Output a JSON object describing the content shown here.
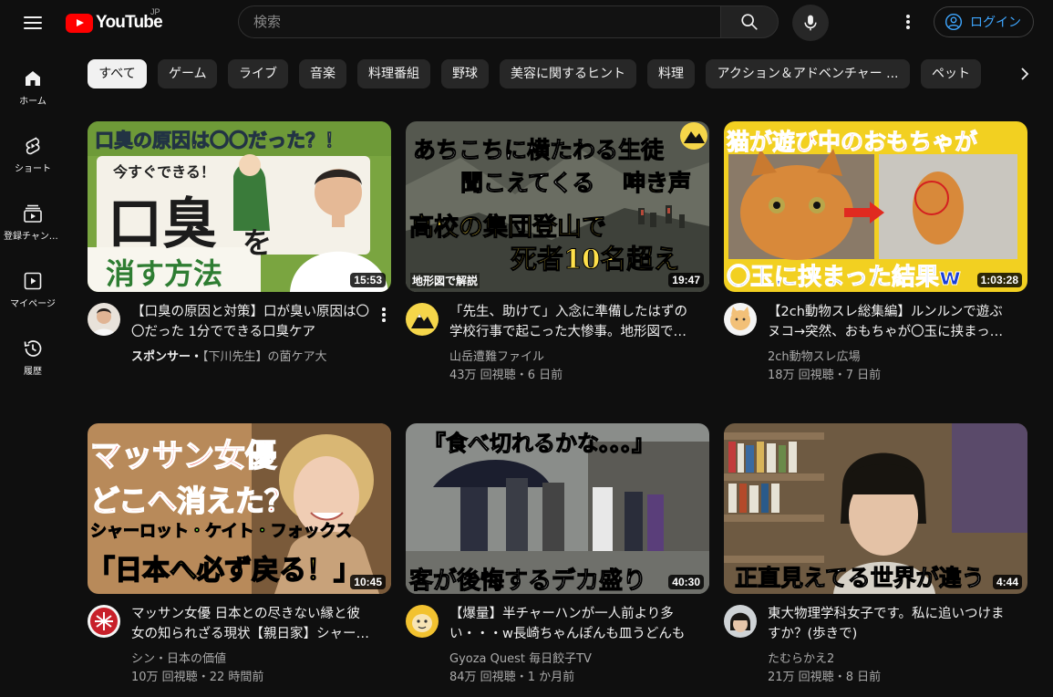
{
  "header": {
    "logo_text": "YouTube",
    "region": "JP",
    "search_placeholder": "検索",
    "login_label": "ログイン"
  },
  "sidebar": {
    "items": [
      {
        "label": "ホーム",
        "icon": "home-icon"
      },
      {
        "label": "ショート",
        "icon": "shorts-icon"
      },
      {
        "label": "登録チャンネル",
        "icon": "subscriptions-icon"
      },
      {
        "label": "マイページ",
        "icon": "you-icon"
      },
      {
        "label": "履歴",
        "icon": "history-icon"
      }
    ]
  },
  "chips": [
    "すべて",
    "ゲーム",
    "ライブ",
    "音楽",
    "料理番組",
    "野球",
    "美容に関するヒント",
    "料理",
    "アクション＆アドベンチャー ...",
    "ペット"
  ],
  "videos": [
    {
      "title": "【口臭の原因と対策】口が臭い原因は〇〇だった 1分でできる口臭ケア",
      "channel": "【下川先生】の菌ケア大",
      "sponsor_label": "スポンサー・",
      "views": "",
      "date": "",
      "duration": "15:53",
      "thumb_lines": [
        "口臭の原因は〇〇だった？！",
        "今すぐできる！",
        "口臭",
        "を",
        "消す方法"
      ]
    },
    {
      "title": "「先生、助けて」入念に準備したはずの学校行事で起こった大惨事。地形図で解説",
      "channel": "山岳遭難ファイル",
      "views": "43万 回視聴",
      "date": "6 日前",
      "duration": "19:47",
      "thumb_lines": [
        "あちこちに横たわる生徒",
        "聞こえてくる",
        "呻き声",
        "高校の集団登山で",
        "死者10名超え",
        "地形図で解説"
      ]
    },
    {
      "title": "【2ch動物スレ総集編】ルンルンで遊ぶヌコ→突然、おもちゃが〇玉に挟まった結果",
      "channel": "2ch動物スレ広場",
      "views": "18万 回視聴",
      "date": "7 日前",
      "duration": "1:03:28",
      "thumb_lines": [
        "猫が遊び中のおもちゃが",
        "〇玉に挟まった結果w"
      ]
    },
    {
      "title": "マッサン女優 日本との尽きない縁と彼女の知られざる現状【親日家】シャーロット・ケイト・フォックス",
      "channel": "シン・日本の価値",
      "views": "10万 回視聴",
      "date": "22 時間前",
      "duration": "10:45",
      "thumb_lines": [
        "マッサン女優",
        "どこへ消えた？",
        "シャーロット・ケイト・フォックス",
        "「日本へ必ず戻る！」"
      ]
    },
    {
      "title": "【爆量】半チャーハンが一人前より多い・・・w長崎ちゃんぽんも皿うどんも",
      "channel": "Gyoza Quest 毎日餃子TV",
      "views": "84万 回視聴",
      "date": "1 か月前",
      "duration": "40:30",
      "thumb_lines": [
        "『食べ切れるかな。。。』",
        "客が後悔するデカ盛り"
      ]
    },
    {
      "title": "東大物理学科女子です。私に追いつけますか？(歩きで)",
      "channel": "たむらかえ2",
      "views": "21万 回視聴",
      "date": "8 日前",
      "duration": "4:44",
      "thumb_lines": [
        "正直見えてる世界が違う"
      ]
    }
  ],
  "meta_separator": "・"
}
